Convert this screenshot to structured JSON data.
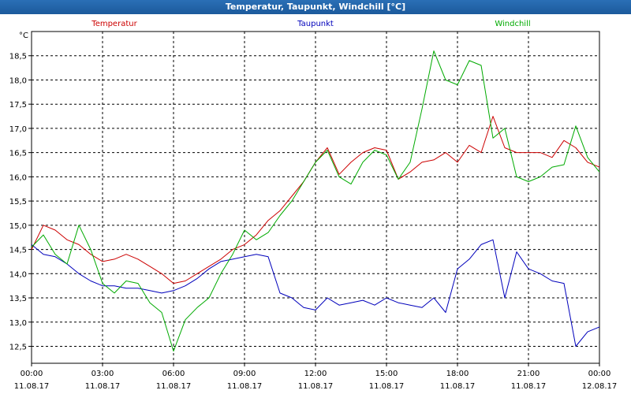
{
  "window": {
    "title": "Temperatur, Taupunkt, Windchill [°C]"
  },
  "chart_data": {
    "type": "line",
    "title": "Temperatur, Taupunkt, Windchill [°C]",
    "ylabel": "°C",
    "ylim": [
      12.15,
      19.0
    ],
    "xlim": [
      "2017-08-11 00:00",
      "2017-08-12 00:00"
    ],
    "grid": true,
    "legend_position": "top",
    "y_ticks": [
      "12,5",
      "13,0",
      "13,5",
      "14,0",
      "14,5",
      "15,0",
      "15,5",
      "16,0",
      "16,5",
      "17,0",
      "17,5",
      "18,0",
      "18,5"
    ],
    "x_ticks": [
      {
        "time": "00:00",
        "date": "11.08.17"
      },
      {
        "time": "03:00",
        "date": "11.08.17"
      },
      {
        "time": "06:00",
        "date": "11.08.17"
      },
      {
        "time": "09:00",
        "date": "11.08.17"
      },
      {
        "time": "12:00",
        "date": "11.08.17"
      },
      {
        "time": "15:00",
        "date": "11.08.17"
      },
      {
        "time": "18:00",
        "date": "11.08.17"
      },
      {
        "time": "21:00",
        "date": "11.08.17"
      },
      {
        "time": "00:00",
        "date": "12.08.17"
      }
    ],
    "x": [
      "00:00",
      "00:30",
      "01:00",
      "01:30",
      "02:00",
      "02:30",
      "03:00",
      "03:30",
      "04:00",
      "04:30",
      "05:00",
      "05:30",
      "06:00",
      "06:30",
      "07:00",
      "07:30",
      "08:00",
      "08:30",
      "09:00",
      "09:30",
      "10:00",
      "10:30",
      "11:00",
      "11:30",
      "12:00",
      "12:30",
      "13:00",
      "13:30",
      "14:00",
      "14:30",
      "15:00",
      "15:30",
      "16:00",
      "16:30",
      "17:00",
      "17:30",
      "18:00",
      "18:30",
      "19:00",
      "19:30",
      "20:00",
      "20:30",
      "21:00",
      "21:30",
      "22:00",
      "22:30",
      "23:00",
      "23:30",
      "24:00"
    ],
    "series": [
      {
        "name": "Temperatur",
        "color": "#cc0000",
        "values": [
          14.5,
          15.0,
          14.9,
          14.7,
          14.6,
          14.4,
          14.25,
          14.3,
          14.4,
          14.3,
          14.15,
          14.0,
          13.8,
          13.85,
          14.0,
          14.15,
          14.3,
          14.5,
          14.6,
          14.8,
          15.1,
          15.3,
          15.6,
          15.9,
          16.3,
          16.6,
          16.05,
          16.3,
          16.5,
          16.6,
          16.55,
          15.95,
          16.1,
          16.3,
          16.35,
          16.5,
          16.3,
          16.65,
          16.5,
          17.25,
          16.6,
          16.5,
          16.5,
          16.5,
          16.4,
          16.75,
          16.6,
          16.3,
          16.2
        ]
      },
      {
        "name": "Taupunkt",
        "color": "#0000bb",
        "values": [
          14.6,
          14.4,
          14.35,
          14.2,
          14.0,
          13.85,
          13.75,
          13.75,
          13.7,
          13.7,
          13.65,
          13.6,
          13.65,
          13.75,
          13.9,
          14.1,
          14.25,
          14.3,
          14.35,
          14.4,
          14.35,
          13.6,
          13.5,
          13.3,
          13.25,
          13.5,
          13.35,
          13.4,
          13.45,
          13.35,
          13.5,
          13.4,
          13.35,
          13.3,
          13.5,
          13.2,
          14.1,
          14.3,
          14.6,
          14.7,
          13.5,
          14.45,
          14.1,
          14.0,
          13.85,
          13.8,
          12.5,
          12.8,
          12.9
        ]
      },
      {
        "name": "Windchill",
        "color": "#00aa00",
        "values": [
          14.55,
          14.8,
          14.4,
          14.2,
          15.0,
          14.5,
          13.8,
          13.6,
          13.85,
          13.8,
          13.4,
          13.2,
          12.4,
          13.05,
          13.3,
          13.5,
          14.0,
          14.4,
          14.9,
          14.7,
          14.85,
          15.2,
          15.5,
          15.9,
          16.3,
          16.55,
          16.0,
          15.85,
          16.3,
          16.55,
          16.45,
          15.95,
          16.3,
          17.4,
          18.6,
          18.0,
          17.9,
          18.4,
          18.3,
          16.8,
          17.0,
          16.0,
          15.9,
          16.0,
          16.2,
          16.25,
          17.05,
          16.4,
          16.1
        ]
      }
    ]
  }
}
